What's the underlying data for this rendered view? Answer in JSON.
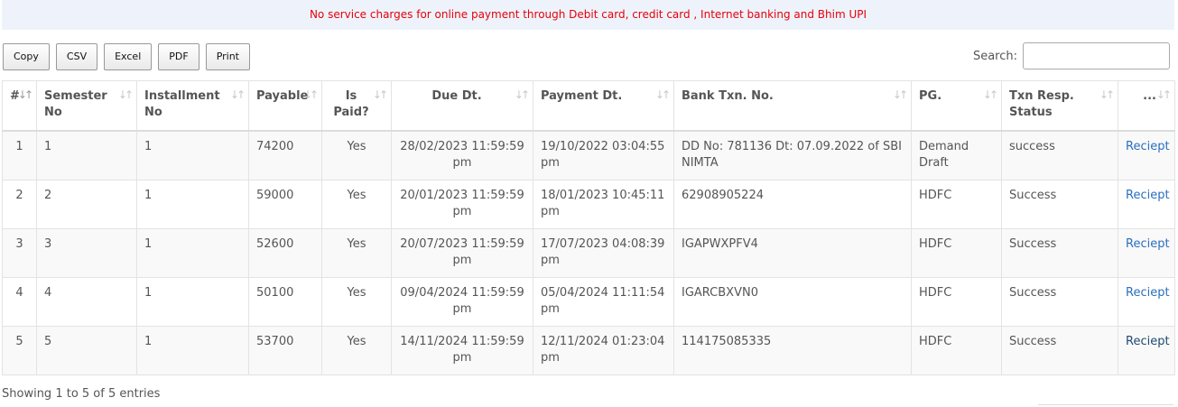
{
  "notice": "No service charges for online payment through Debit card, credit card , Internet banking and Bhim UPI",
  "toolbar": {
    "copy": "Copy",
    "csv": "CSV",
    "excel": "Excel",
    "pdf": "PDF",
    "print": "Print"
  },
  "search": {
    "label": "Search:",
    "value": ""
  },
  "table": {
    "headers": [
      "#",
      "Semester No",
      "Installment No",
      "Payable",
      "Is Paid?",
      "Due Dt.",
      "Payment Dt.",
      "Bank Txn. No.",
      "PG.",
      "Txn Resp. Status",
      "..."
    ],
    "rows": [
      {
        "idx": "1",
        "semester": "1",
        "installment": "1",
        "payable": "74200",
        "paid": "Yes",
        "due": "28/02/2023 11:59:59 pm",
        "payment": "19/10/2022 03:04:55 pm",
        "bank_txn": "DD No: 781136 Dt: 07.09.2022 of SBI NIMTA",
        "pg": "Demand Draft",
        "status": "success",
        "action": "Reciept"
      },
      {
        "idx": "2",
        "semester": "2",
        "installment": "1",
        "payable": "59000",
        "paid": "Yes",
        "due": "20/01/2023 11:59:59 pm",
        "payment": "18/01/2023 10:45:11 pm",
        "bank_txn": "62908905224",
        "pg": "HDFC",
        "status": "Success",
        "action": "Reciept"
      },
      {
        "idx": "3",
        "semester": "3",
        "installment": "1",
        "payable": "52600",
        "paid": "Yes",
        "due": "20/07/2023 11:59:59 pm",
        "payment": "17/07/2023 04:08:39 pm",
        "bank_txn": "IGAPWXPFV4",
        "pg": "HDFC",
        "status": "Success",
        "action": "Reciept"
      },
      {
        "idx": "4",
        "semester": "4",
        "installment": "1",
        "payable": "50100",
        "paid": "Yes",
        "due": "09/04/2024 11:59:59 pm",
        "payment": "05/04/2024 11:11:54 pm",
        "bank_txn": "IGARCBXVN0",
        "pg": "HDFC",
        "status": "Success",
        "action": "Reciept"
      },
      {
        "idx": "5",
        "semester": "5",
        "installment": "1",
        "payable": "53700",
        "paid": "Yes",
        "due": "14/11/2024 11:59:59 pm",
        "payment": "12/11/2024 01:23:04 pm",
        "bank_txn": "114175085335",
        "pg": "HDFC",
        "status": "Success",
        "action": "Reciept"
      }
    ]
  },
  "footer": {
    "info": "Showing 1 to 5 of 5 entries"
  },
  "colors": {
    "notice_text": "#e8000b",
    "notice_bg": "#eef3fb",
    "link": "#2a6fbd"
  },
  "icons": {
    "sort": "sort-arrows-icon",
    "sort_asc": "sort-ascending-icon"
  }
}
